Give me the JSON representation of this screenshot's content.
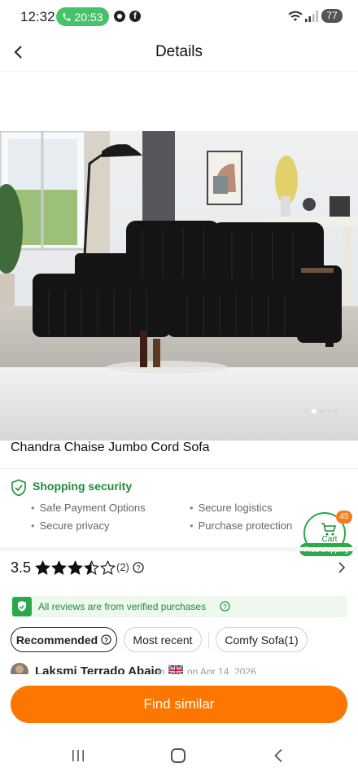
{
  "status_bar": {
    "time": "12:32",
    "call_timer": "20:53",
    "battery": "77"
  },
  "header": {
    "title": "Details"
  },
  "gallery": {
    "image_alt": "Black corduroy sectional sofa with chaise in a living room",
    "slide_count": 5,
    "active_slide": 2
  },
  "product": {
    "title": "Chandra Chaise Jumbo Cord Sofa"
  },
  "security": {
    "title": "Shopping security",
    "items": [
      "Safe Payment Options",
      "Secure logistics",
      "Secure privacy",
      "Purchase protection"
    ]
  },
  "cart": {
    "label": "Cart",
    "badge": "45",
    "free_shipping": "Free shipping"
  },
  "rating": {
    "score": "3.5",
    "stars": 3.5,
    "count": "(2)"
  },
  "verified": {
    "text": "All reviews are from verified purchases"
  },
  "filters": {
    "chips": [
      "Recommended",
      "Most recent",
      "Comfy Sofa(1)"
    ]
  },
  "review": {
    "name": "Laksmi Terrado Abaio",
    "in_text": "in",
    "date": "on Apr 14, 2026"
  },
  "cta": {
    "find_similar": "Find similar"
  },
  "colors": {
    "accent": "#fb7701",
    "green": "#2aa84a",
    "call_green": "#48c26a"
  }
}
